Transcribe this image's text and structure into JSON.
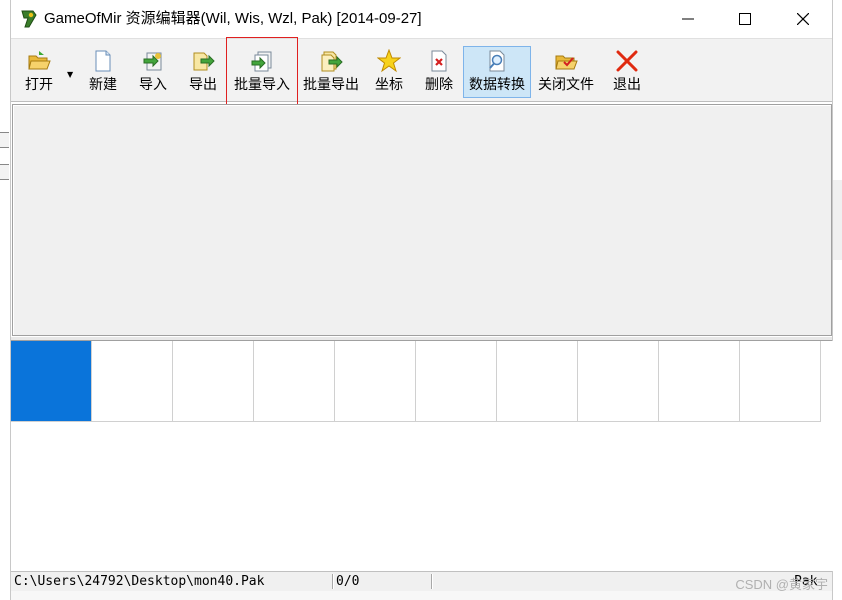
{
  "window": {
    "title": "GameOfMir 资源编辑器(Wil, Wis, Wzl, Pak) [2014-09-27]"
  },
  "toolbar": {
    "buttons": [
      {
        "label": "打开",
        "icon": "folder-open-icon"
      },
      {
        "label": "新建",
        "icon": "new-file-icon"
      },
      {
        "label": "导入",
        "icon": "import-icon"
      },
      {
        "label": "导出",
        "icon": "export-icon"
      },
      {
        "label": "批量导入",
        "icon": "batch-import-icon"
      },
      {
        "label": "批量导出",
        "icon": "batch-export-icon"
      },
      {
        "label": "坐标",
        "icon": "star-icon"
      },
      {
        "label": "删除",
        "icon": "delete-icon"
      },
      {
        "label": "数据转换",
        "icon": "convert-icon"
      },
      {
        "label": "关闭文件",
        "icon": "close-file-icon"
      },
      {
        "label": "退出",
        "icon": "exit-icon"
      }
    ]
  },
  "statusbar": {
    "path": "C:\\Users\\24792\\Desktop\\mon40.Pak",
    "count": "0/0",
    "format": "Pak"
  },
  "watermark": "CSDN @黄家宇",
  "colors": {
    "selection": "#0a74da",
    "highlight_border": "#e02020",
    "active_button": "#cde6f7"
  }
}
